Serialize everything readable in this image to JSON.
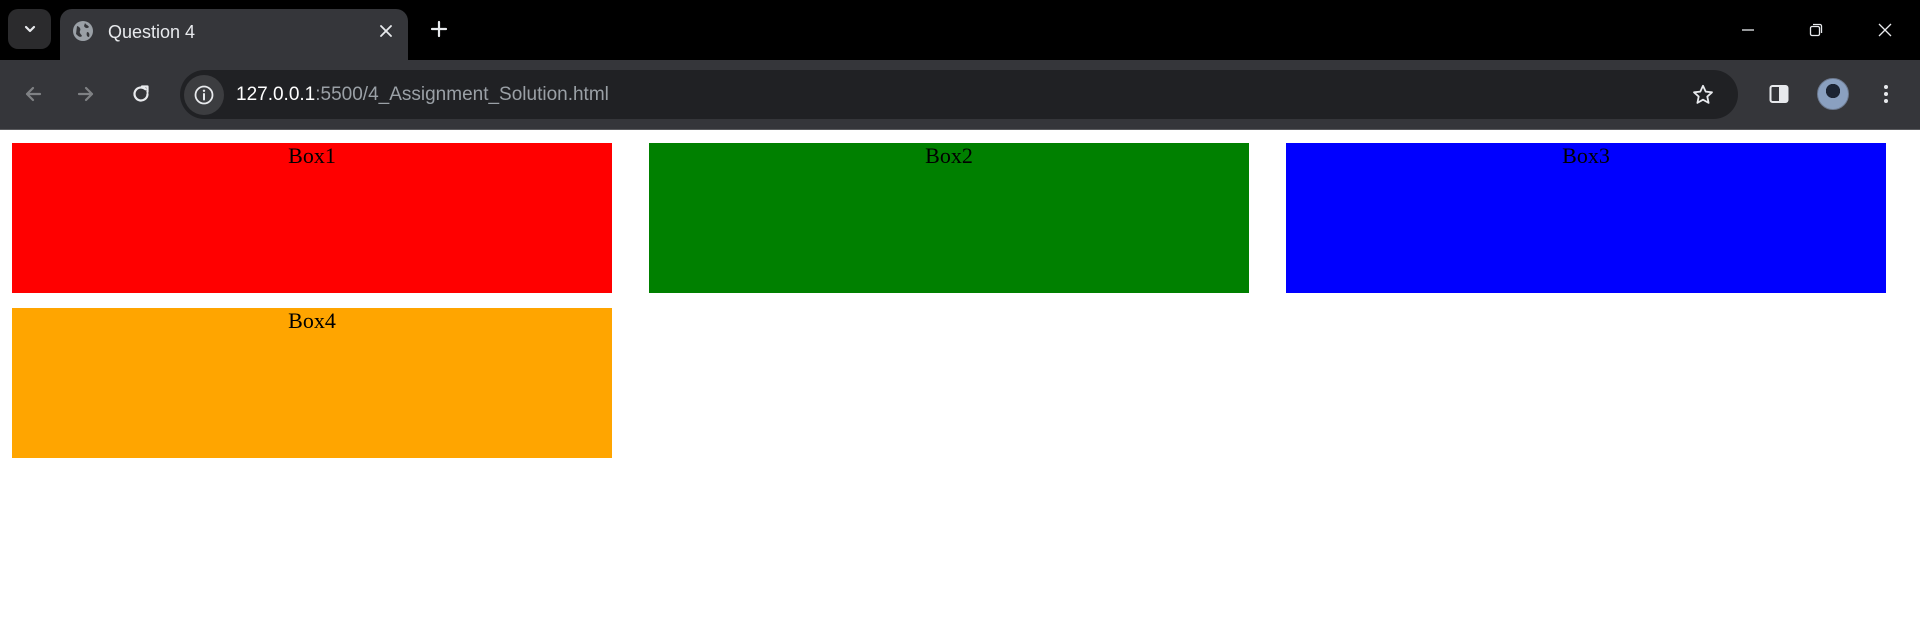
{
  "browser": {
    "tab": {
      "title": "Question 4"
    },
    "address": {
      "host": "127.0.0.1",
      "path": ":5500/4_Assignment_Solution.html"
    }
  },
  "page": {
    "boxes": [
      {
        "label": "Box1",
        "color": "#ff0000"
      },
      {
        "label": "Box2",
        "color": "#008000"
      },
      {
        "label": "Box3",
        "color": "#0000ff"
      },
      {
        "label": "Box4",
        "color": "#ffa500"
      }
    ]
  },
  "icons": {
    "tab_search": "chevron-down-icon",
    "favicon": "globe-icon",
    "tab_close": "close-icon",
    "new_tab": "plus-icon",
    "minimize": "minimize-icon",
    "restore": "restore-icon",
    "close_window": "close-icon",
    "back": "arrow-left-icon",
    "forward": "arrow-right-icon",
    "reload": "reload-icon",
    "site_info": "info-icon",
    "bookmark": "star-icon",
    "side_panel": "side-panel-icon",
    "menu": "kebab-menu-icon"
  }
}
